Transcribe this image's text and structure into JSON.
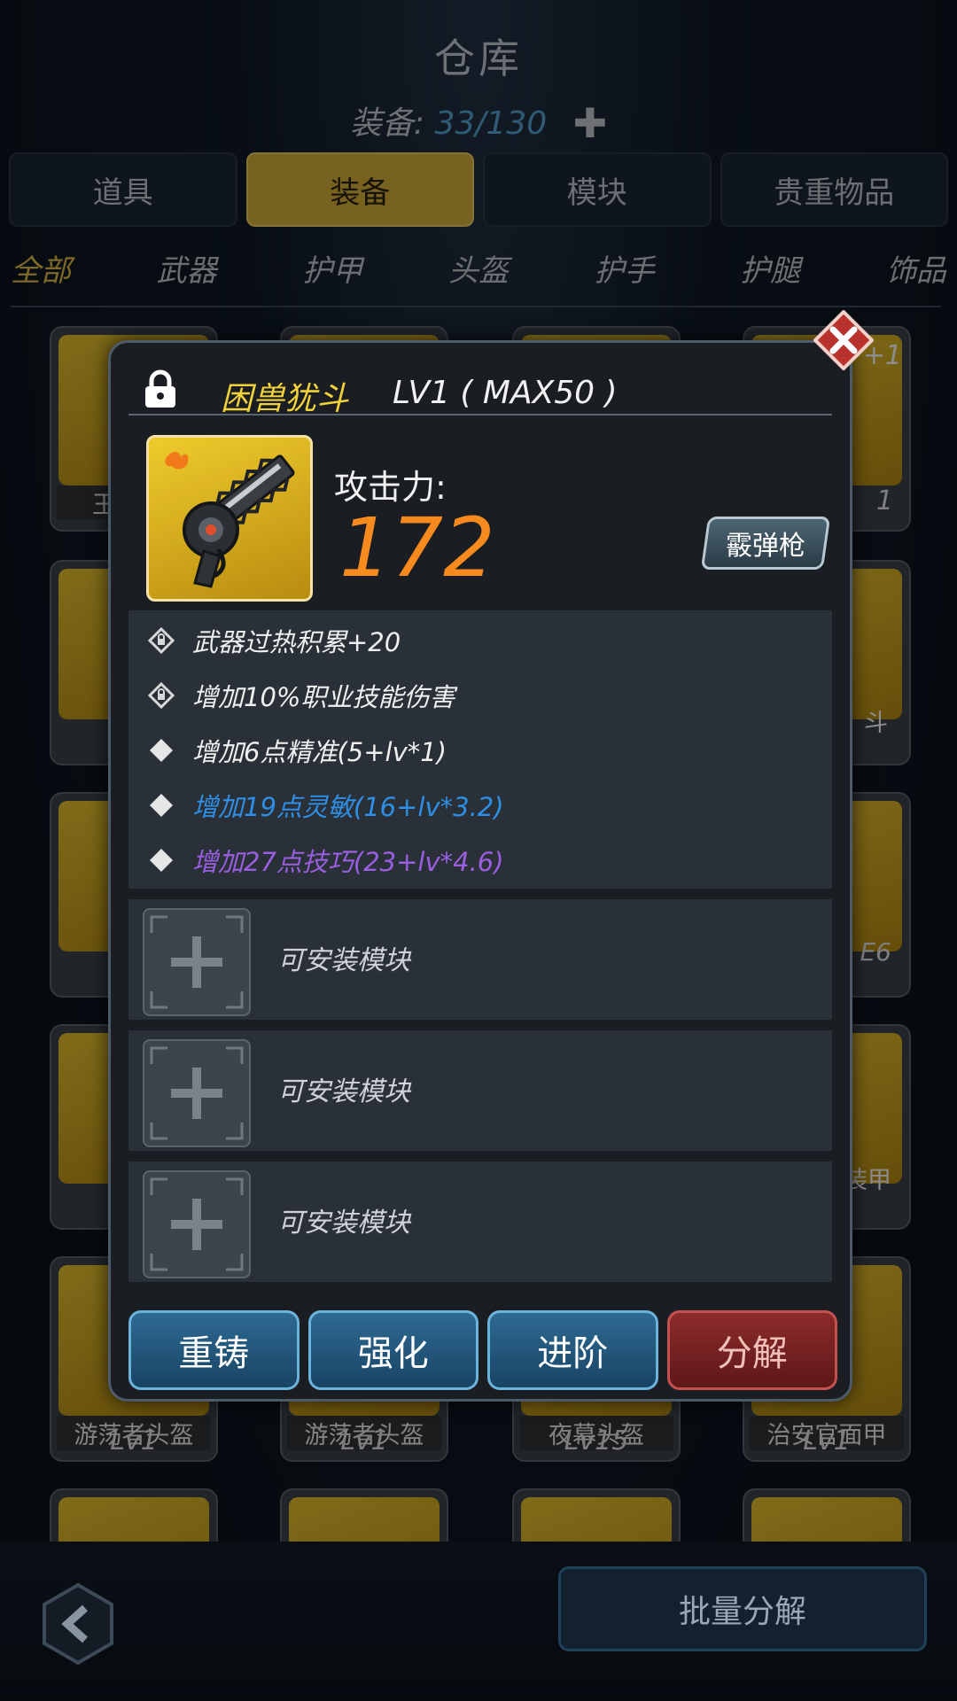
{
  "header": {
    "title": "仓库",
    "capacity_label": "装备:",
    "capacity_value": "33/130"
  },
  "tabs": [
    {
      "label": "道具"
    },
    {
      "label": "装备"
    },
    {
      "label": "模块"
    },
    {
      "label": "贵重物品"
    }
  ],
  "active_tab": "装备",
  "subtabs": [
    {
      "label": "全部"
    },
    {
      "label": "武器"
    },
    {
      "label": "护甲"
    },
    {
      "label": "头盔"
    },
    {
      "label": "护手"
    },
    {
      "label": "护腿"
    },
    {
      "label": "饰品"
    }
  ],
  "active_subtab": "全部",
  "grid": {
    "visible_fragments": [
      "王",
      "+1",
      "1",
      "斗",
      "E6",
      "装甲"
    ],
    "row5": [
      {
        "name": "游荡者头盔",
        "level": "Lv1"
      },
      {
        "name": "游荡者头盔",
        "level": "Lv1"
      },
      {
        "name": "夜幕头盔",
        "level": "Lv15"
      },
      {
        "name": "治安官面甲",
        "level": "Lv1"
      }
    ]
  },
  "footer": {
    "batch_label": "批量分解"
  },
  "modal": {
    "item_name": "困兽犹斗",
    "level_text": "LV1 ( MAX50 )",
    "attack_label": "攻击力:",
    "attack_value": "172",
    "weapon_type": "霰弹枪",
    "stats": [
      {
        "text": "武器过热积累+20",
        "icon": "locked-diamond-icon",
        "color": "#f0f0f0"
      },
      {
        "text": "增加10%职业技能伤害",
        "icon": "locked-diamond-icon",
        "color": "#f0f0f0"
      },
      {
        "text": "增加6点精准(5+lv*1)",
        "icon": "diamond-icon",
        "color": "#f0f0f0"
      },
      {
        "text": "增加19点灵敏(16+lv*3.2)",
        "icon": "diamond-icon",
        "color": "#2e8fe6"
      },
      {
        "text": "增加27点技巧(23+lv*4.6)",
        "icon": "diamond-icon",
        "color": "#9a5fe0"
      }
    ],
    "module_slots": [
      {
        "label": "可安装模块"
      },
      {
        "label": "可安装模块"
      },
      {
        "label": "可安装模块"
      }
    ],
    "actions": {
      "recast": "重铸",
      "enhance": "强化",
      "advance": "进阶",
      "dismantle": "分解"
    }
  },
  "colors": {
    "accent_gold": "#d9b53a",
    "attack_orange": "#f68a1f",
    "blue_stat": "#2e8fe6",
    "purple_stat": "#9a5fe0"
  }
}
